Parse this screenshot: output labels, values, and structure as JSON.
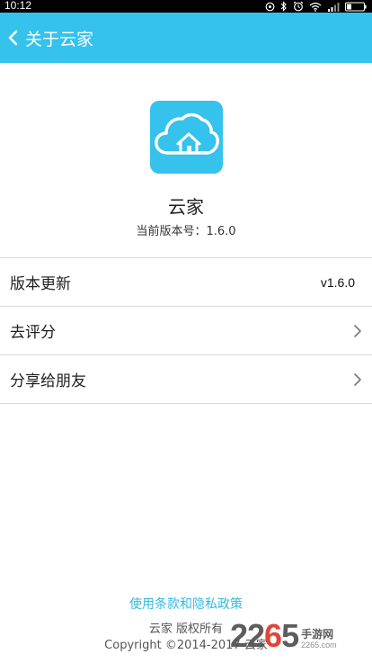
{
  "status_bar": {
    "time": "10:12",
    "icons": [
      "alarm-circle-icon",
      "bluetooth-icon",
      "alarm-clock-icon",
      "wifi-icon",
      "signal-icon",
      "battery-icon"
    ]
  },
  "app_bar": {
    "back_icon": "chevron-left-icon",
    "title": "关于云家",
    "color": "#35C2EC"
  },
  "app_info": {
    "icon": "cloud-house-icon",
    "name": "云家",
    "version_text": "当前版本号：1.6.0"
  },
  "menu": {
    "items": [
      {
        "label": "版本更新",
        "value": "v1.6.0"
      },
      {
        "label": "去评分",
        "icon": "chevron-right-icon"
      },
      {
        "label": "分享给朋友",
        "icon": "chevron-right-icon"
      }
    ]
  },
  "footer": {
    "policy_link": "使用条款和隐私政策",
    "copyright_line1": "云家 版权所有",
    "copyright_line2": "Copyright ©2014-2017 云家",
    "link_color": "#35B9E0"
  },
  "watermark": {
    "number_prefix": "22",
    "number_red": "6",
    "number_suffix": "5",
    "subtitle": "手游网",
    "domain": "2265.com"
  }
}
